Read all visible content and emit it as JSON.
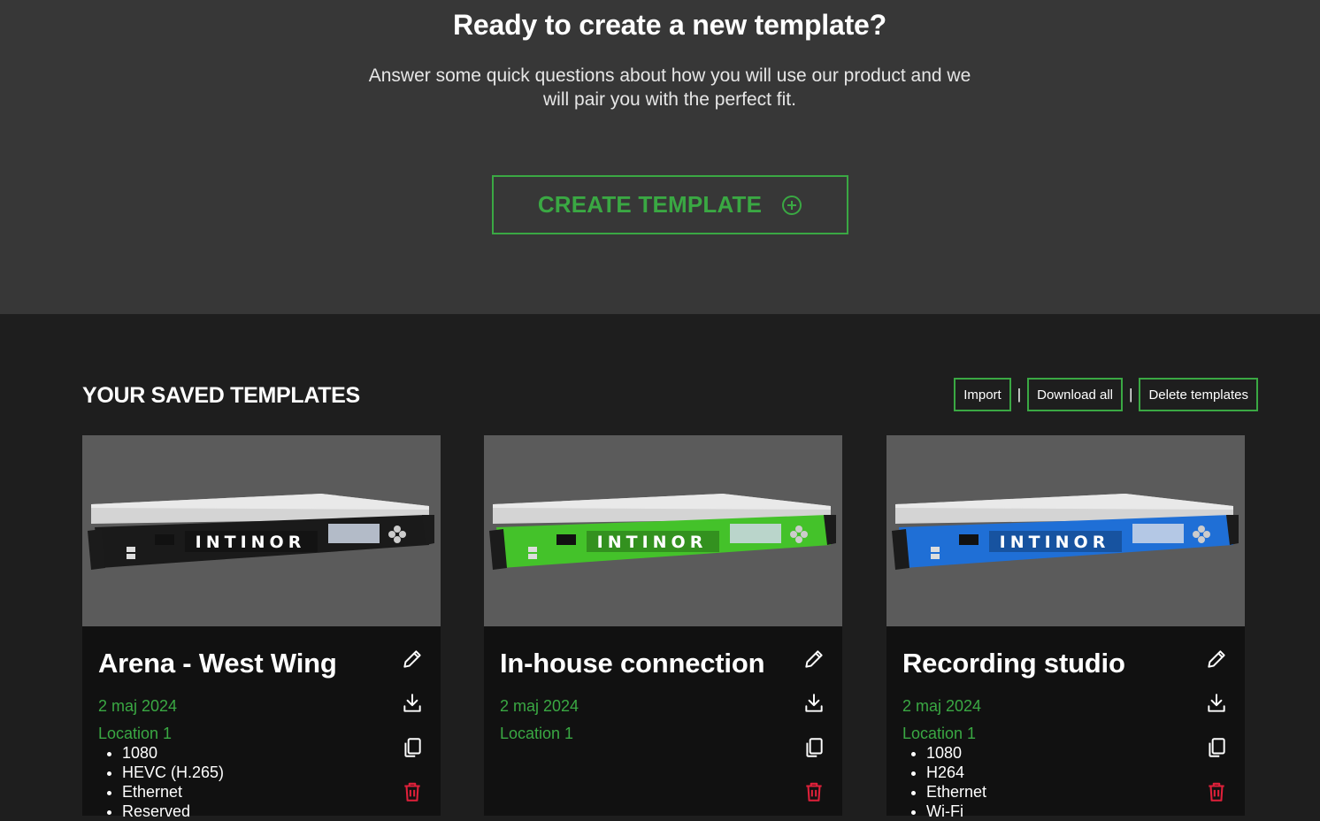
{
  "hero": {
    "title": "Ready to create a new template?",
    "subtitle_line1": "Answer some quick questions about how you will use our product and we",
    "subtitle_line2": "will pair you with the perfect fit.",
    "create_button_label": "CREATE TEMPLATE",
    "create_button_icon": "plus-circle-icon"
  },
  "saved": {
    "title": "YOUR SAVED TEMPLATES",
    "import_label": "Import",
    "separator": "|",
    "download_all_label": "Download all",
    "delete_label": "Delete templates"
  },
  "colors": {
    "accent_green": "#3aa843",
    "delete_red": "#e0203a",
    "hero_bg": "#373737",
    "page_bg": "#1e1e1e",
    "card_bg": "#111111",
    "card_image_bg": "#5b5b5b"
  },
  "cards": [
    {
      "title": "Arena - West Wing",
      "date": "2 maj 2024",
      "location": "Location 1",
      "features": [
        "1080",
        "HEVC (H.265)",
        "Ethernet",
        "Reserved"
      ],
      "device_color": "#1a1a1a",
      "device_brand": "INTINOR",
      "icons": [
        "pencil-icon",
        "download-icon",
        "copy-icon",
        "trash-icon"
      ]
    },
    {
      "title": "In-house connection",
      "date": "2 maj 2024",
      "location": "Location 1",
      "features": [],
      "device_color": "#44c22a",
      "device_brand": "INTINOR",
      "icons": [
        "pencil-icon",
        "download-icon",
        "copy-icon",
        "trash-icon"
      ]
    },
    {
      "title": "Recording studio",
      "date": "2 maj 2024",
      "location": "Location 1",
      "features": [
        "1080",
        "H264",
        "Ethernet",
        "Wi-Fi"
      ],
      "device_color": "#1f6fd6",
      "device_brand": "INTINOR",
      "icons": [
        "pencil-icon",
        "download-icon",
        "copy-icon",
        "trash-icon"
      ]
    }
  ]
}
